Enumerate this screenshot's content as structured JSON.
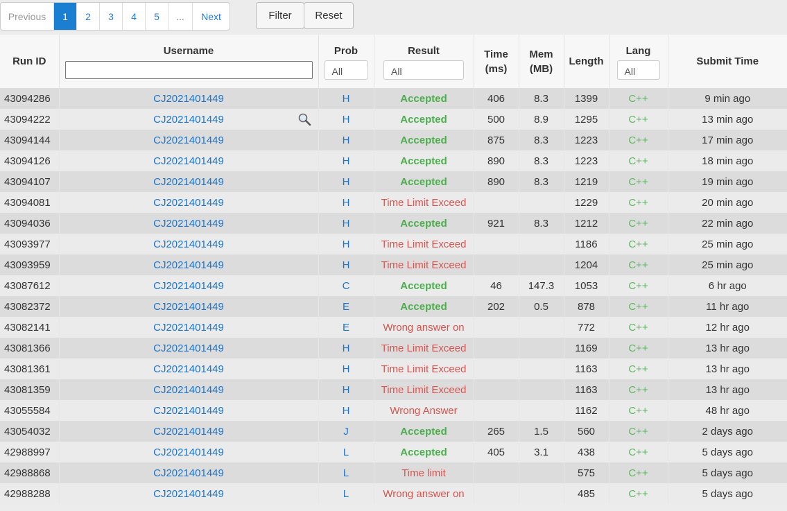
{
  "pagination": {
    "previous": "Previous",
    "pages": [
      "1",
      "2",
      "3",
      "4",
      "5"
    ],
    "ellipsis": "...",
    "next": "Next",
    "active_page": "1"
  },
  "buttons": {
    "filter": "Filter",
    "reset": "Reset"
  },
  "columns": {
    "run_id": "Run ID",
    "username": "Username",
    "prob": "Prob",
    "result": "Result",
    "time_line1": "Time",
    "time_line2": "(ms)",
    "mem_line1": "Mem",
    "mem_line2": "(MB)",
    "length": "Length",
    "lang": "Lang",
    "submit_time": "Submit Time"
  },
  "filters": {
    "username_value": "",
    "prob_selected": "All",
    "result_selected": "All",
    "lang_selected": "All"
  },
  "colors": {
    "link": "#1b74c9",
    "accepted": "#4cae4c",
    "error": "#d9534f",
    "lang": "#5cb85c",
    "active_page": "#1a7fd0"
  },
  "icons": {
    "user_search": "magnifier-icon"
  },
  "rows": [
    {
      "run_id": "43094286",
      "user": "CJ2021401449",
      "prob": "H",
      "result": "Accepted",
      "status": "ok",
      "time": "406",
      "mem": "8.3",
      "length": "1399",
      "lang": "C++",
      "submitted": "9 min ago"
    },
    {
      "run_id": "43094222",
      "user": "CJ2021401449",
      "prob": "H",
      "result": "Accepted",
      "status": "ok",
      "time": "500",
      "mem": "8.9",
      "length": "1295",
      "lang": "C++",
      "submitted": "13 min ago"
    },
    {
      "run_id": "43094144",
      "user": "CJ2021401449",
      "prob": "H",
      "result": "Accepted",
      "status": "ok",
      "time": "875",
      "mem": "8.3",
      "length": "1223",
      "lang": "C++",
      "submitted": "17 min ago"
    },
    {
      "run_id": "43094126",
      "user": "CJ2021401449",
      "prob": "H",
      "result": "Accepted",
      "status": "ok",
      "time": "890",
      "mem": "8.3",
      "length": "1223",
      "lang": "C++",
      "submitted": "18 min ago"
    },
    {
      "run_id": "43094107",
      "user": "CJ2021401449",
      "prob": "H",
      "result": "Accepted",
      "status": "ok",
      "time": "890",
      "mem": "8.3",
      "length": "1219",
      "lang": "C++",
      "submitted": "19 min ago"
    },
    {
      "run_id": "43094081",
      "user": "CJ2021401449",
      "prob": "H",
      "result": "Time Limit Exceed",
      "status": "bad",
      "time": "",
      "mem": "",
      "length": "1229",
      "lang": "C++",
      "submitted": "20 min ago"
    },
    {
      "run_id": "43094036",
      "user": "CJ2021401449",
      "prob": "H",
      "result": "Accepted",
      "status": "ok",
      "time": "921",
      "mem": "8.3",
      "length": "1212",
      "lang": "C++",
      "submitted": "22 min ago"
    },
    {
      "run_id": "43093977",
      "user": "CJ2021401449",
      "prob": "H",
      "result": "Time Limit Exceed",
      "status": "bad",
      "time": "",
      "mem": "",
      "length": "1186",
      "lang": "C++",
      "submitted": "25 min ago"
    },
    {
      "run_id": "43093959",
      "user": "CJ2021401449",
      "prob": "H",
      "result": "Time Limit Exceed",
      "status": "bad",
      "time": "",
      "mem": "",
      "length": "1204",
      "lang": "C++",
      "submitted": "25 min ago"
    },
    {
      "run_id": "43087612",
      "user": "CJ2021401449",
      "prob": "C",
      "result": "Accepted",
      "status": "ok",
      "time": "46",
      "mem": "147.3",
      "length": "1053",
      "lang": "C++",
      "submitted": "6 hr ago"
    },
    {
      "run_id": "43082372",
      "user": "CJ2021401449",
      "prob": "E",
      "result": "Accepted",
      "status": "ok",
      "time": "202",
      "mem": "0.5",
      "length": "878",
      "lang": "C++",
      "submitted": "11 hr ago"
    },
    {
      "run_id": "43082141",
      "user": "CJ2021401449",
      "prob": "E",
      "result": "Wrong answer on",
      "status": "bad",
      "time": "",
      "mem": "",
      "length": "772",
      "lang": "C++",
      "submitted": "12 hr ago"
    },
    {
      "run_id": "43081366",
      "user": "CJ2021401449",
      "prob": "H",
      "result": "Time Limit Exceed",
      "status": "bad",
      "time": "",
      "mem": "",
      "length": "1169",
      "lang": "C++",
      "submitted": "13 hr ago"
    },
    {
      "run_id": "43081361",
      "user": "CJ2021401449",
      "prob": "H",
      "result": "Time Limit Exceed",
      "status": "bad",
      "time": "",
      "mem": "",
      "length": "1163",
      "lang": "C++",
      "submitted": "13 hr ago"
    },
    {
      "run_id": "43081359",
      "user": "CJ2021401449",
      "prob": "H",
      "result": "Time Limit Exceed",
      "status": "bad",
      "time": "",
      "mem": "",
      "length": "1163",
      "lang": "C++",
      "submitted": "13 hr ago"
    },
    {
      "run_id": "43055584",
      "user": "CJ2021401449",
      "prob": "H",
      "result": "Wrong Answer",
      "status": "bad",
      "time": "",
      "mem": "",
      "length": "1162",
      "lang": "C++",
      "submitted": "48 hr ago"
    },
    {
      "run_id": "43054032",
      "user": "CJ2021401449",
      "prob": "J",
      "result": "Accepted",
      "status": "ok",
      "time": "265",
      "mem": "1.5",
      "length": "560",
      "lang": "C++",
      "submitted": "2 days ago"
    },
    {
      "run_id": "42988997",
      "user": "CJ2021401449",
      "prob": "L",
      "result": "Accepted",
      "status": "ok",
      "time": "405",
      "mem": "3.1",
      "length": "438",
      "lang": "C++",
      "submitted": "5 days ago"
    },
    {
      "run_id": "42988868",
      "user": "CJ2021401449",
      "prob": "L",
      "result": "Time limit",
      "status": "bad",
      "time": "",
      "mem": "",
      "length": "575",
      "lang": "C++",
      "submitted": "5 days ago"
    },
    {
      "run_id": "42988288",
      "user": "CJ2021401449",
      "prob": "L",
      "result": "Wrong answer on",
      "status": "bad",
      "time": "",
      "mem": "",
      "length": "485",
      "lang": "C++",
      "submitted": "5 days ago"
    }
  ]
}
